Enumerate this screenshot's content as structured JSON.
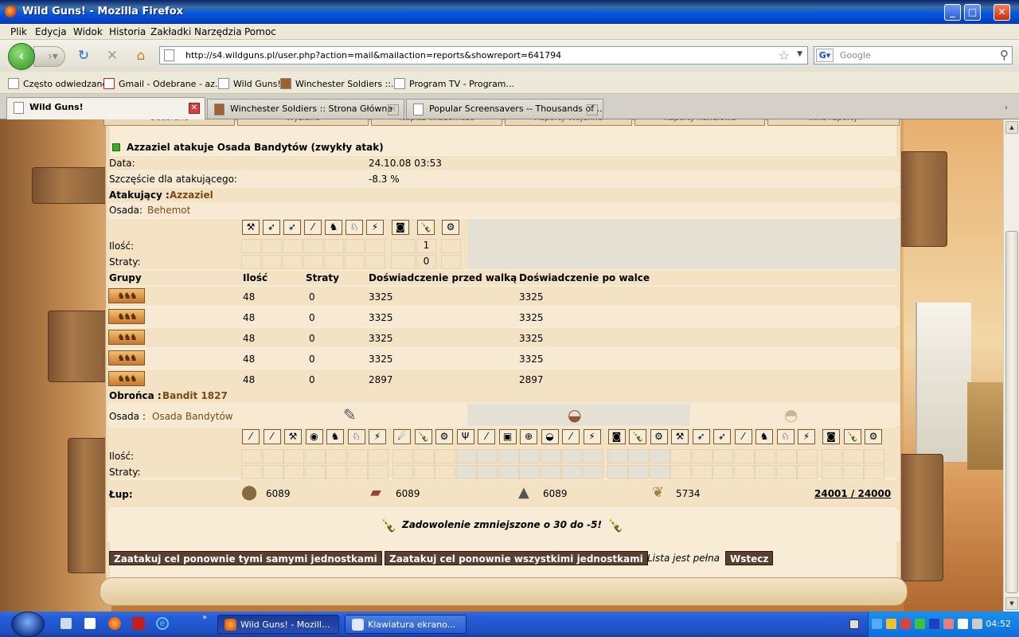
{
  "window": {
    "title": "Wild Guns! - Mozilla Firefox"
  },
  "menu": [
    "Plik",
    "Edycja",
    "Widok",
    "Historia",
    "Zakładki",
    "Narzędzia",
    "Pomoc"
  ],
  "url": "http://s4.wildguns.pl/user.php?action=mail&mailaction=reports&showreport=641794",
  "search_placeholder": "Google",
  "bookmarks": [
    "Często odwiedzane",
    "Gmail - Odebrane - az...",
    "Wild Guns!",
    "Winchester Soldiers ::...",
    "Program TV - Program..."
  ],
  "tabs": [
    "Wild Guns!",
    "Winchester Soldiers :: Strona Główna",
    "Popular Screensavers -- Thousands of ..."
  ],
  "subtabs": [
    "Odebrane",
    "Wysłane",
    "Napisz Wiadomość",
    "Raporty Wojenne",
    "Raporty handlowe",
    "Inne raporty"
  ],
  "report": {
    "title": "Azzaziel atakuje Osada Bandytów (zwykły atak)",
    "date_label": "Data:",
    "date_value": "24.10.08 03:53",
    "luck_label": "Szczęście dla atakującego:",
    "luck_value": "-8.3 %",
    "attacker_label": "Atakujący :",
    "attacker_name": "Azzaziel",
    "settlement_label": "Osada:",
    "settlement_name": "Behemot",
    "qty_label": "Ilość:",
    "loss_label": "Straty:",
    "attacker_qty": [
      "",
      "",
      "",
      "",
      "",
      "",
      "",
      "",
      "1",
      ""
    ],
    "attacker_loss": [
      "",
      "",
      "",
      "",
      "",
      "",
      "",
      "",
      "0",
      ""
    ],
    "groups_header": [
      "Grupy",
      "Ilość",
      "Straty",
      "Doświadczenie przed walką",
      "Doświadczenie po walce"
    ],
    "groups": [
      {
        "qty": "48",
        "loss": "0",
        "before": "3325",
        "after": "3325"
      },
      {
        "qty": "48",
        "loss": "0",
        "before": "3325",
        "after": "3325"
      },
      {
        "qty": "48",
        "loss": "0",
        "before": "3325",
        "after": "3325"
      },
      {
        "qty": "48",
        "loss": "0",
        "before": "3325",
        "after": "3325"
      },
      {
        "qty": "48",
        "loss": "0",
        "before": "2897",
        "after": "2897"
      }
    ],
    "defender_label": "Obrońca :",
    "defender_name": "Bandit 1827",
    "def_settlement_label": "Osada :",
    "def_settlement_name": "Osada Bandytów",
    "loot_label": "Łup:",
    "loot": [
      "6089",
      "6089",
      "6089",
      "5734"
    ],
    "loot_total": "24001 / 24000",
    "satisfaction": "Zadowolenie zmniejszone o 30 do -5!",
    "btn_same": "Zaatakuj cel ponownie tymi samymi jednostkami",
    "btn_all": "Zaatakuj cel ponownie wszystkimi jednostkami",
    "list_full": "Lista jest pełna",
    "btn_back": "Wstecz"
  },
  "taskbar": {
    "items": [
      "Wild Guns! - Mozill...",
      "Klawiatura ekrano..."
    ],
    "clock": "04:52"
  }
}
